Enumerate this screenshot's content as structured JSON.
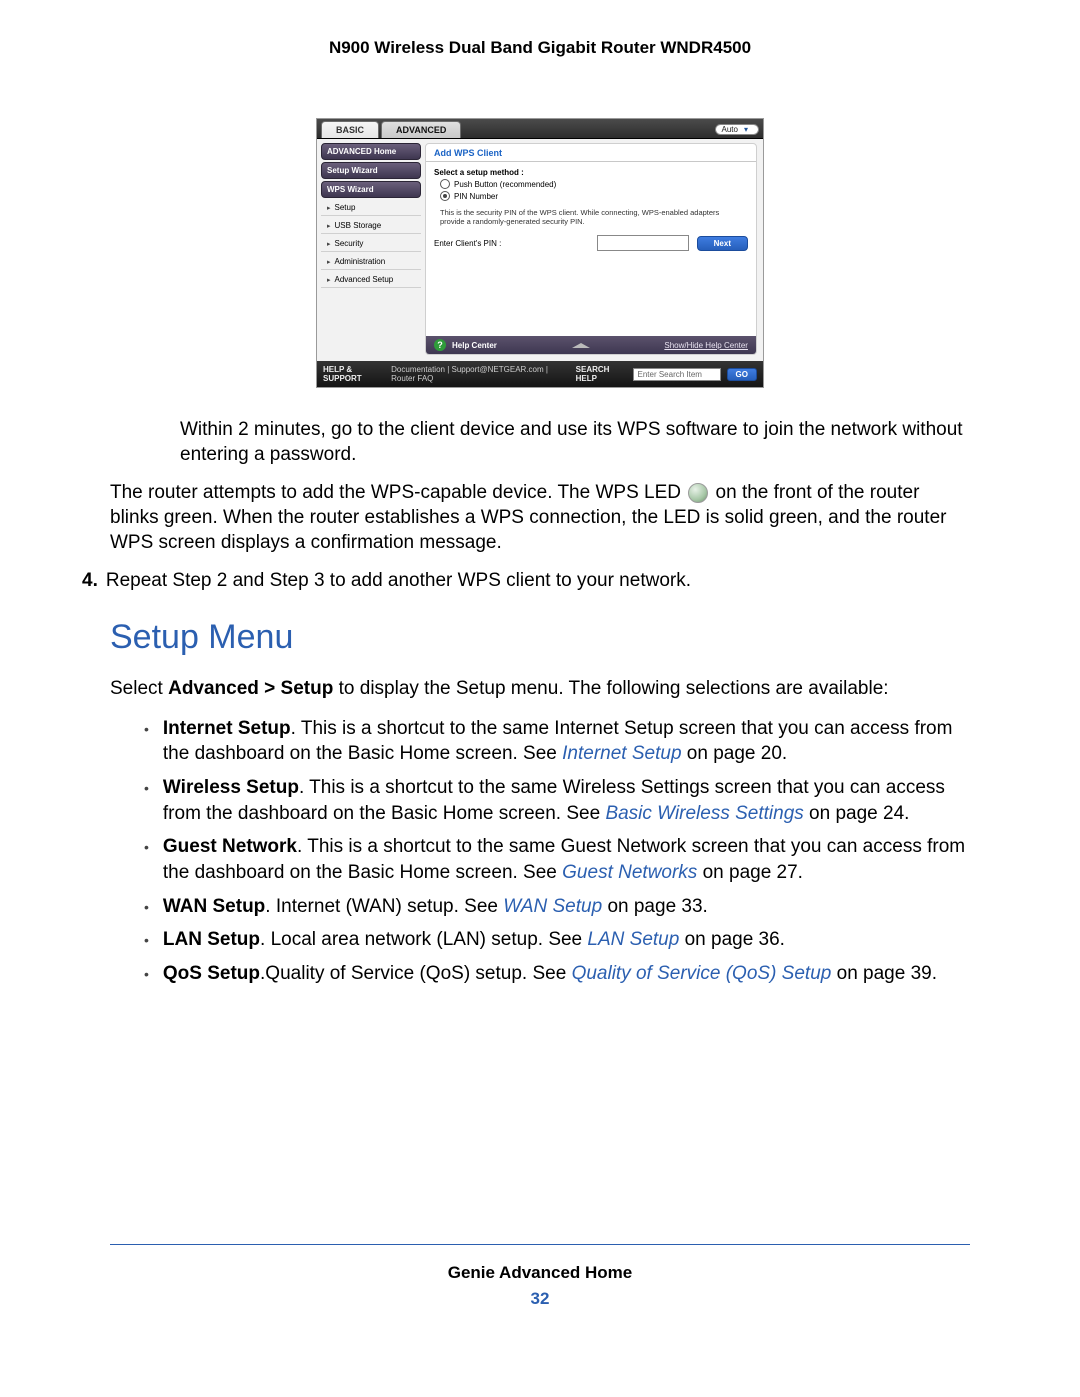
{
  "header_title": "N900 Wireless Dual Band Gigabit Router WNDR4500",
  "router": {
    "tabs": {
      "basic": "BASIC",
      "advanced": "ADVANCED",
      "auto": "Auto"
    },
    "sidebar": {
      "advanced_home": "ADVANCED Home",
      "setup_wizard": "Setup Wizard",
      "wps_wizard": "WPS Wizard",
      "setup": "Setup",
      "usb_storage": "USB Storage",
      "security": "Security",
      "administration": "Administration",
      "advanced_setup": "Advanced Setup"
    },
    "panel": {
      "title": "Add WPS Client",
      "select_method": "Select a setup method :",
      "opt_push": "Push Button (recommended)",
      "opt_pin": "PIN Number",
      "hint": "This is the security PIN of the WPS client. While connecting, WPS-enabled adapters provide a randomly-generated security PIN.",
      "enter_pin": "Enter Client's PIN :",
      "next": "Next"
    },
    "help_center": {
      "label": "Help Center",
      "toggle": "Show/Hide Help Center"
    },
    "footer": {
      "help_support": "HELP & SUPPORT",
      "links": "Documentation | Support@NETGEAR.com | Router FAQ",
      "search_help": "SEARCH HELP",
      "placeholder": "Enter Search Item",
      "go": "GO"
    }
  },
  "body": {
    "p1": "Within 2 minutes, go to the client device and use its WPS software to join the network without entering a password.",
    "p2a": "The router attempts to add the WPS-capable device. The WPS LED ",
    "p2b": " on the front of the router blinks green. When the router establishes a WPS connection, the LED is solid green, and the router WPS screen displays a confirmation message.",
    "step4_num": "4.",
    "step4_text": "Repeat Step 2 and Step 3 to add another WPS client to your network.",
    "h2": "Setup Menu",
    "p3a": "Select ",
    "p3b": "Advanced > Setup",
    "p3c": " to display the Setup menu. The following selections are available:",
    "bullets": [
      {
        "bold": "Internet Setup",
        "rest": ". This is a shortcut to the same Internet Setup screen that you can access from the dashboard on the Basic Home screen. See ",
        "link": "Internet Setup",
        "tail": " on page 20."
      },
      {
        "bold": "Wireless Setup",
        "rest": ". This is a shortcut to the same Wireless Settings screen that you can access from the dashboard on the Basic Home screen. See ",
        "link": "Basic Wireless Settings",
        "tail": " on page 24."
      },
      {
        "bold": "Guest Network",
        "rest": ". This is a shortcut to the same Guest Network screen that you can access from the dashboard on the Basic Home screen. See ",
        "link": "Guest Networks",
        "tail": " on page 27."
      },
      {
        "bold": "WAN Setup",
        "rest": ". Internet (WAN) setup. See ",
        "link": "WAN Setup",
        "tail": " on page 33."
      },
      {
        "bold": "LAN Setup",
        "rest": ". Local area network (LAN) setup. See ",
        "link": "LAN Setup",
        "tail": " on page 36."
      },
      {
        "bold": "QoS Setup",
        "rest": ".Quality of Service (QoS) setup. See ",
        "link": "Quality of Service (QoS) Setup",
        "tail": " on page 39."
      }
    ]
  },
  "footer": {
    "section": "Genie Advanced Home",
    "page_num": "32"
  }
}
